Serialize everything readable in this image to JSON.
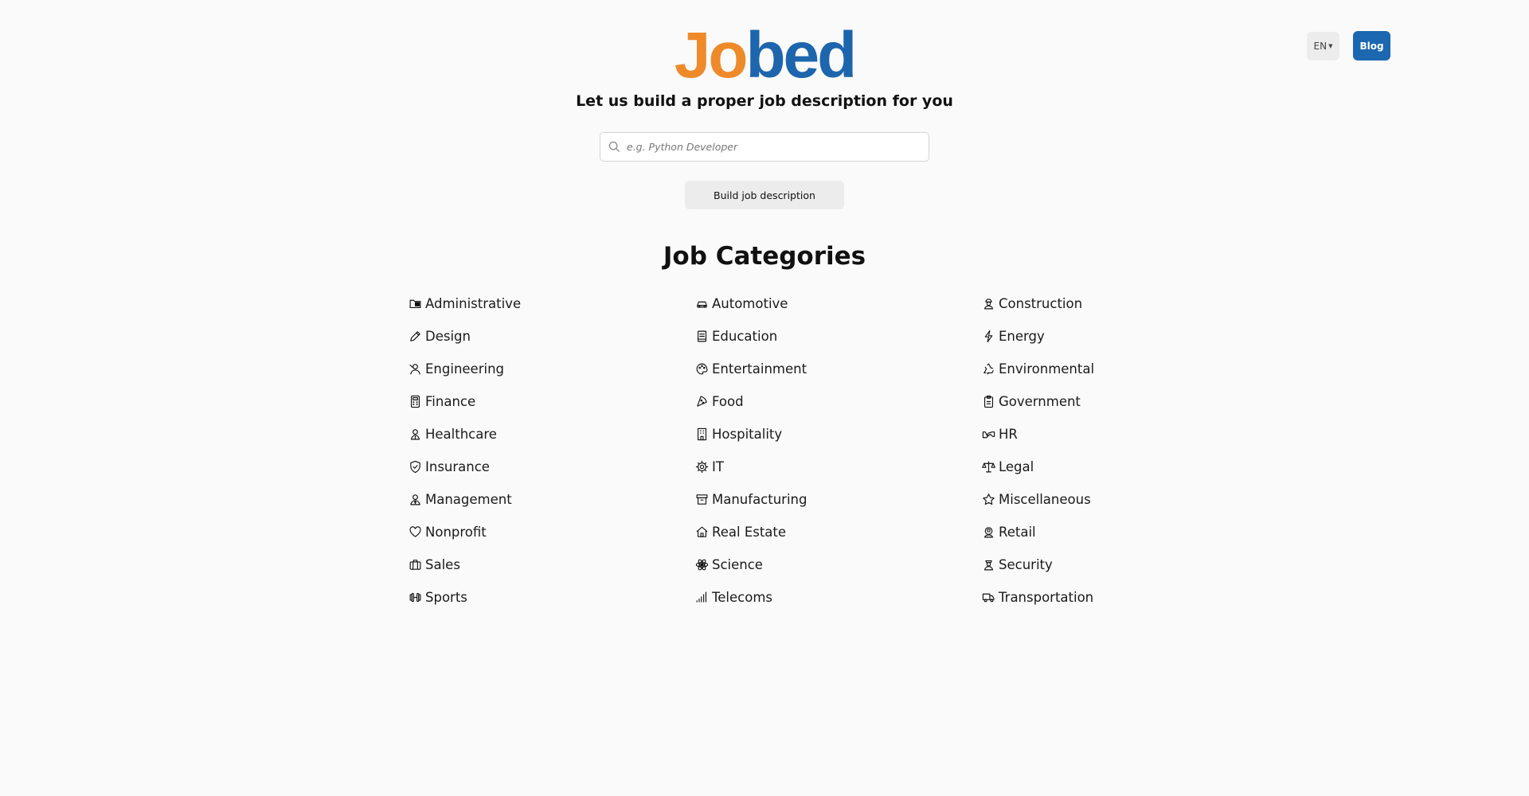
{
  "header": {
    "logo_part1": "Jo",
    "logo_part2": "bed",
    "lang_label": "EN",
    "blog_label": "Blog",
    "tagline": "Let us build a proper job description for you"
  },
  "search": {
    "placeholder": "e.g. Python Developer",
    "value": ""
  },
  "build_button_label": "Build job description",
  "categories_title": "Job Categories",
  "categories": [
    {
      "label": "Administrative",
      "icon": "folder-icon"
    },
    {
      "label": "Automotive",
      "icon": "car-icon"
    },
    {
      "label": "Construction",
      "icon": "worker-icon"
    },
    {
      "label": "Design",
      "icon": "pencil-icon"
    },
    {
      "label": "Education",
      "icon": "book-icon"
    },
    {
      "label": "Energy",
      "icon": "bolt-icon"
    },
    {
      "label": "Engineering",
      "icon": "engineer-icon"
    },
    {
      "label": "Entertainment",
      "icon": "palette-icon"
    },
    {
      "label": "Environmental",
      "icon": "recycle-icon"
    },
    {
      "label": "Finance",
      "icon": "calculator-icon"
    },
    {
      "label": "Food",
      "icon": "pizza-icon"
    },
    {
      "label": "Government",
      "icon": "clipboard-icon"
    },
    {
      "label": "Healthcare",
      "icon": "doctor-icon"
    },
    {
      "label": "Hospitality",
      "icon": "hotel-icon"
    },
    {
      "label": "HR",
      "icon": "handshake-icon"
    },
    {
      "label": "Insurance",
      "icon": "shield-check-icon"
    },
    {
      "label": "IT",
      "icon": "cog-icon"
    },
    {
      "label": "Legal",
      "icon": "scale-icon"
    },
    {
      "label": "Management",
      "icon": "manager-icon"
    },
    {
      "label": "Manufacturing",
      "icon": "archive-icon"
    },
    {
      "label": "Miscellaneous",
      "icon": "star-icon"
    },
    {
      "label": "Nonprofit",
      "icon": "heart-icon"
    },
    {
      "label": "Real Estate",
      "icon": "house-icon"
    },
    {
      "label": "Retail",
      "icon": "user-circle-icon"
    },
    {
      "label": "Sales",
      "icon": "briefcase-icon"
    },
    {
      "label": "Science",
      "icon": "atom-icon"
    },
    {
      "label": "Security",
      "icon": "guard-icon"
    },
    {
      "label": "Sports",
      "icon": "dumbbell-icon"
    },
    {
      "label": "Telecoms",
      "icon": "signal-icon"
    },
    {
      "label": "Transportation",
      "icon": "truck-icon"
    }
  ],
  "colors": {
    "logo_orange": "#ef8a2a",
    "logo_blue": "#1d65ad",
    "blog_button": "#1b67b0",
    "background": "#fafafa"
  }
}
